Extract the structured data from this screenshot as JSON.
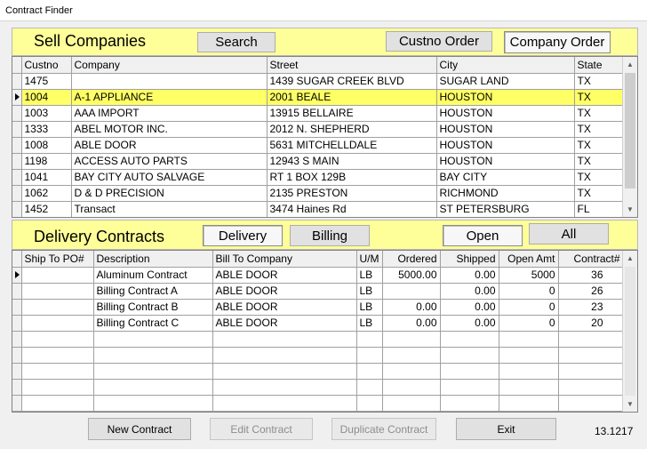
{
  "window": {
    "title": "Contract Finder"
  },
  "sell": {
    "title": "Sell Companies",
    "search_label": "Search",
    "custno_order_label": "Custno Order",
    "company_order_label": "Company Order",
    "columns": [
      "Custno",
      "Company",
      "Street",
      "City",
      "State"
    ],
    "rows": [
      {
        "custno": "1475",
        "company": "",
        "street": "1439 SUGAR CREEK BLVD",
        "city": "SUGAR LAND",
        "state": "TX"
      },
      {
        "custno": "1004",
        "company": "A-1 APPLIANCE",
        "street": "2001 BEALE",
        "city": "HOUSTON",
        "state": "TX"
      },
      {
        "custno": "1003",
        "company": "AAA IMPORT",
        "street": "13915 BELLAIRE",
        "city": "HOUSTON",
        "state": "TX"
      },
      {
        "custno": "1333",
        "company": "ABEL MOTOR INC.",
        "street": "2012 N. SHEPHERD",
        "city": "HOUSTON",
        "state": "TX"
      },
      {
        "custno": "1008",
        "company": "ABLE DOOR",
        "street": "5631 MITCHELLDALE",
        "city": "HOUSTON",
        "state": "TX"
      },
      {
        "custno": "1198",
        "company": "ACCESS AUTO PARTS",
        "street": "12943 S MAIN",
        "city": "HOUSTON",
        "state": "TX"
      },
      {
        "custno": "1041",
        "company": "BAY CITY AUTO SALVAGE",
        "street": "RT 1 BOX 129B",
        "city": "BAY CITY",
        "state": "TX"
      },
      {
        "custno": "1062",
        "company": "D & D PRECISION",
        "street": "2135 PRESTON",
        "city": "RICHMOND",
        "state": "TX"
      },
      {
        "custno": "1452",
        "company": "Transact",
        "street": "3474 Haines Rd",
        "city": "ST PETERSBURG",
        "state": "FL"
      }
    ]
  },
  "delivery": {
    "title": "Delivery Contracts",
    "delivery_label": "Delivery",
    "billing_label": "Billing",
    "open_label": "Open",
    "all_label": "All",
    "columns": [
      "Ship To PO#",
      "Description",
      "Bill To Company",
      "U/M",
      "Ordered",
      "Shipped",
      "Open Amt",
      "Contract#"
    ],
    "rows": [
      {
        "po": "",
        "desc": "Aluminum Contract",
        "bill": "ABLE DOOR",
        "um": "LB",
        "ordered": "5000.00",
        "shipped": "0.00",
        "open": "5000",
        "contract": "36"
      },
      {
        "po": "",
        "desc": "Billing Contract A",
        "bill": "ABLE DOOR",
        "um": "LB",
        "ordered": "",
        "shipped": "0.00",
        "open": "0",
        "contract": "26"
      },
      {
        "po": "",
        "desc": "Billing Contract B",
        "bill": "ABLE DOOR",
        "um": "LB",
        "ordered": "0.00",
        "shipped": "0.00",
        "open": "0",
        "contract": "23"
      },
      {
        "po": "",
        "desc": "Billing Contract C",
        "bill": "ABLE DOOR",
        "um": "LB",
        "ordered": "0.00",
        "shipped": "0.00",
        "open": "0",
        "contract": "20"
      }
    ]
  },
  "footer": {
    "new_contract_label": "New Contract",
    "edit_contract_label": "Edit Contract",
    "duplicate_contract_label": "Duplicate Contract",
    "exit_label": "Exit",
    "version": "13.1217"
  }
}
